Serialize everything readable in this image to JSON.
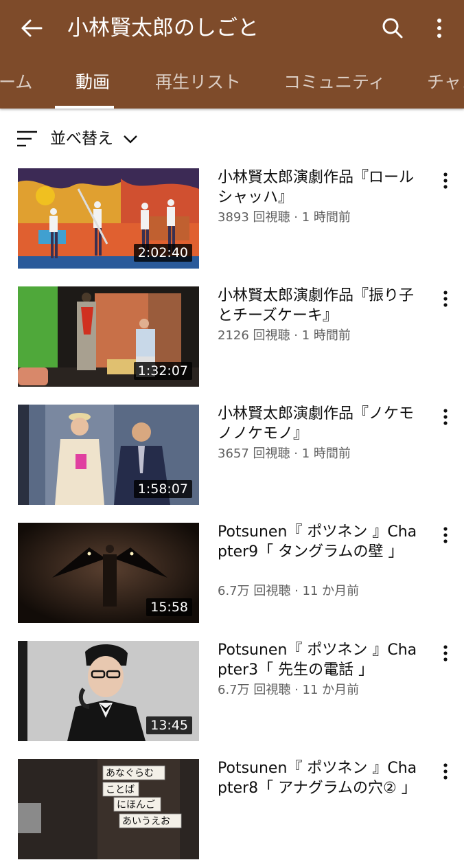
{
  "header": {
    "title": "小林賢太郎のしごと",
    "back_icon": "arrow-back-icon",
    "search_icon": "search-icon",
    "more_icon": "more-vert-icon",
    "color": "#7e4b2a"
  },
  "tabs": [
    {
      "label": "ーム",
      "active": false
    },
    {
      "label": "動画",
      "active": true
    },
    {
      "label": "再生リスト",
      "active": false
    },
    {
      "label": "コミュニティ",
      "active": false
    },
    {
      "label": "チャン",
      "active": false
    }
  ],
  "sort": {
    "label": "並べ替え",
    "icon": "sort-icon"
  },
  "videos": [
    {
      "title": "小林賢太郎演劇作品『ロールシャッハ』",
      "meta": "3893 回視聴 · 1 時間前",
      "duration": "2:02:40"
    },
    {
      "title": "小林賢太郎演劇作品『振り子とチーズケーキ』",
      "meta": "2126 回視聴 · 1 時間前",
      "duration": "1:32:07"
    },
    {
      "title": "小林賢太郎演劇作品『ノケモノノケモノ』",
      "meta": "3657 回視聴 · 1 時間前",
      "duration": "1:58:07"
    },
    {
      "title": "Potsunen『 ポツネン 』Chapter9「 タングラムの壁 」",
      "meta": "6.7万 回視聴 · 11 か月前",
      "duration": "15:58"
    },
    {
      "title": "Potsunen『 ポツネン 』Chapter3「 先生の電話 」",
      "meta": "6.7万 回視聴 · 11 か月前",
      "duration": "13:45"
    },
    {
      "title": "Potsunen『 ポツネン 』Chapter8「 アナグラムの穴② 」",
      "meta": "",
      "duration": ""
    }
  ],
  "thumbnail_words": [
    "あなぐらむ",
    "ことば",
    "にほんご",
    "あいうえお"
  ]
}
